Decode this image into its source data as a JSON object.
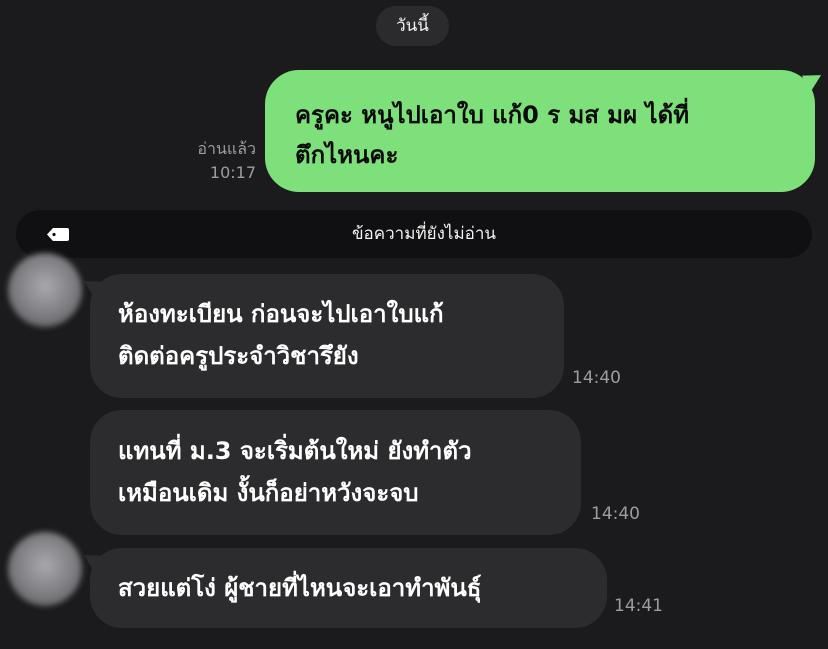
{
  "date_separator": "วันนี้",
  "outgoing": {
    "read_status": "อ่านแล้ว",
    "time": "10:17",
    "lines": [
      "ครูคะ  หนูไปเอาใบ แก้0 ร มส มผ ได้ที่",
      "ตึกไหนคะ"
    ]
  },
  "unread_divider": {
    "icon": "tag-icon",
    "label": "ข้อความที่ยังไม่อ่าน"
  },
  "incoming": [
    {
      "lines": [
        "ห้องทะเบียน ก่อนจะไปเอาใบแก้",
        "ติดต่อครูประจำวิชารึยัง"
      ],
      "time": "14:40"
    },
    {
      "lines": [
        "แทนที่ ม.3 จะเริ่มต้นใหม่ ยังทำตัว",
        "เหมือนเดิม งั้นก็อย่าหวังจะจบ"
      ],
      "time": "14:40"
    },
    {
      "lines": [
        "สวยแต่โง่ ผู้ชายที่ไหนจะเอาทำพันธุ์"
      ],
      "time": "14:41"
    }
  ],
  "colors": {
    "background": "#1b1b1d",
    "outgoing_bubble": "#7ee07b",
    "incoming_bubble": "#2c2c2e",
    "meta_text": "#9d9d9f"
  }
}
